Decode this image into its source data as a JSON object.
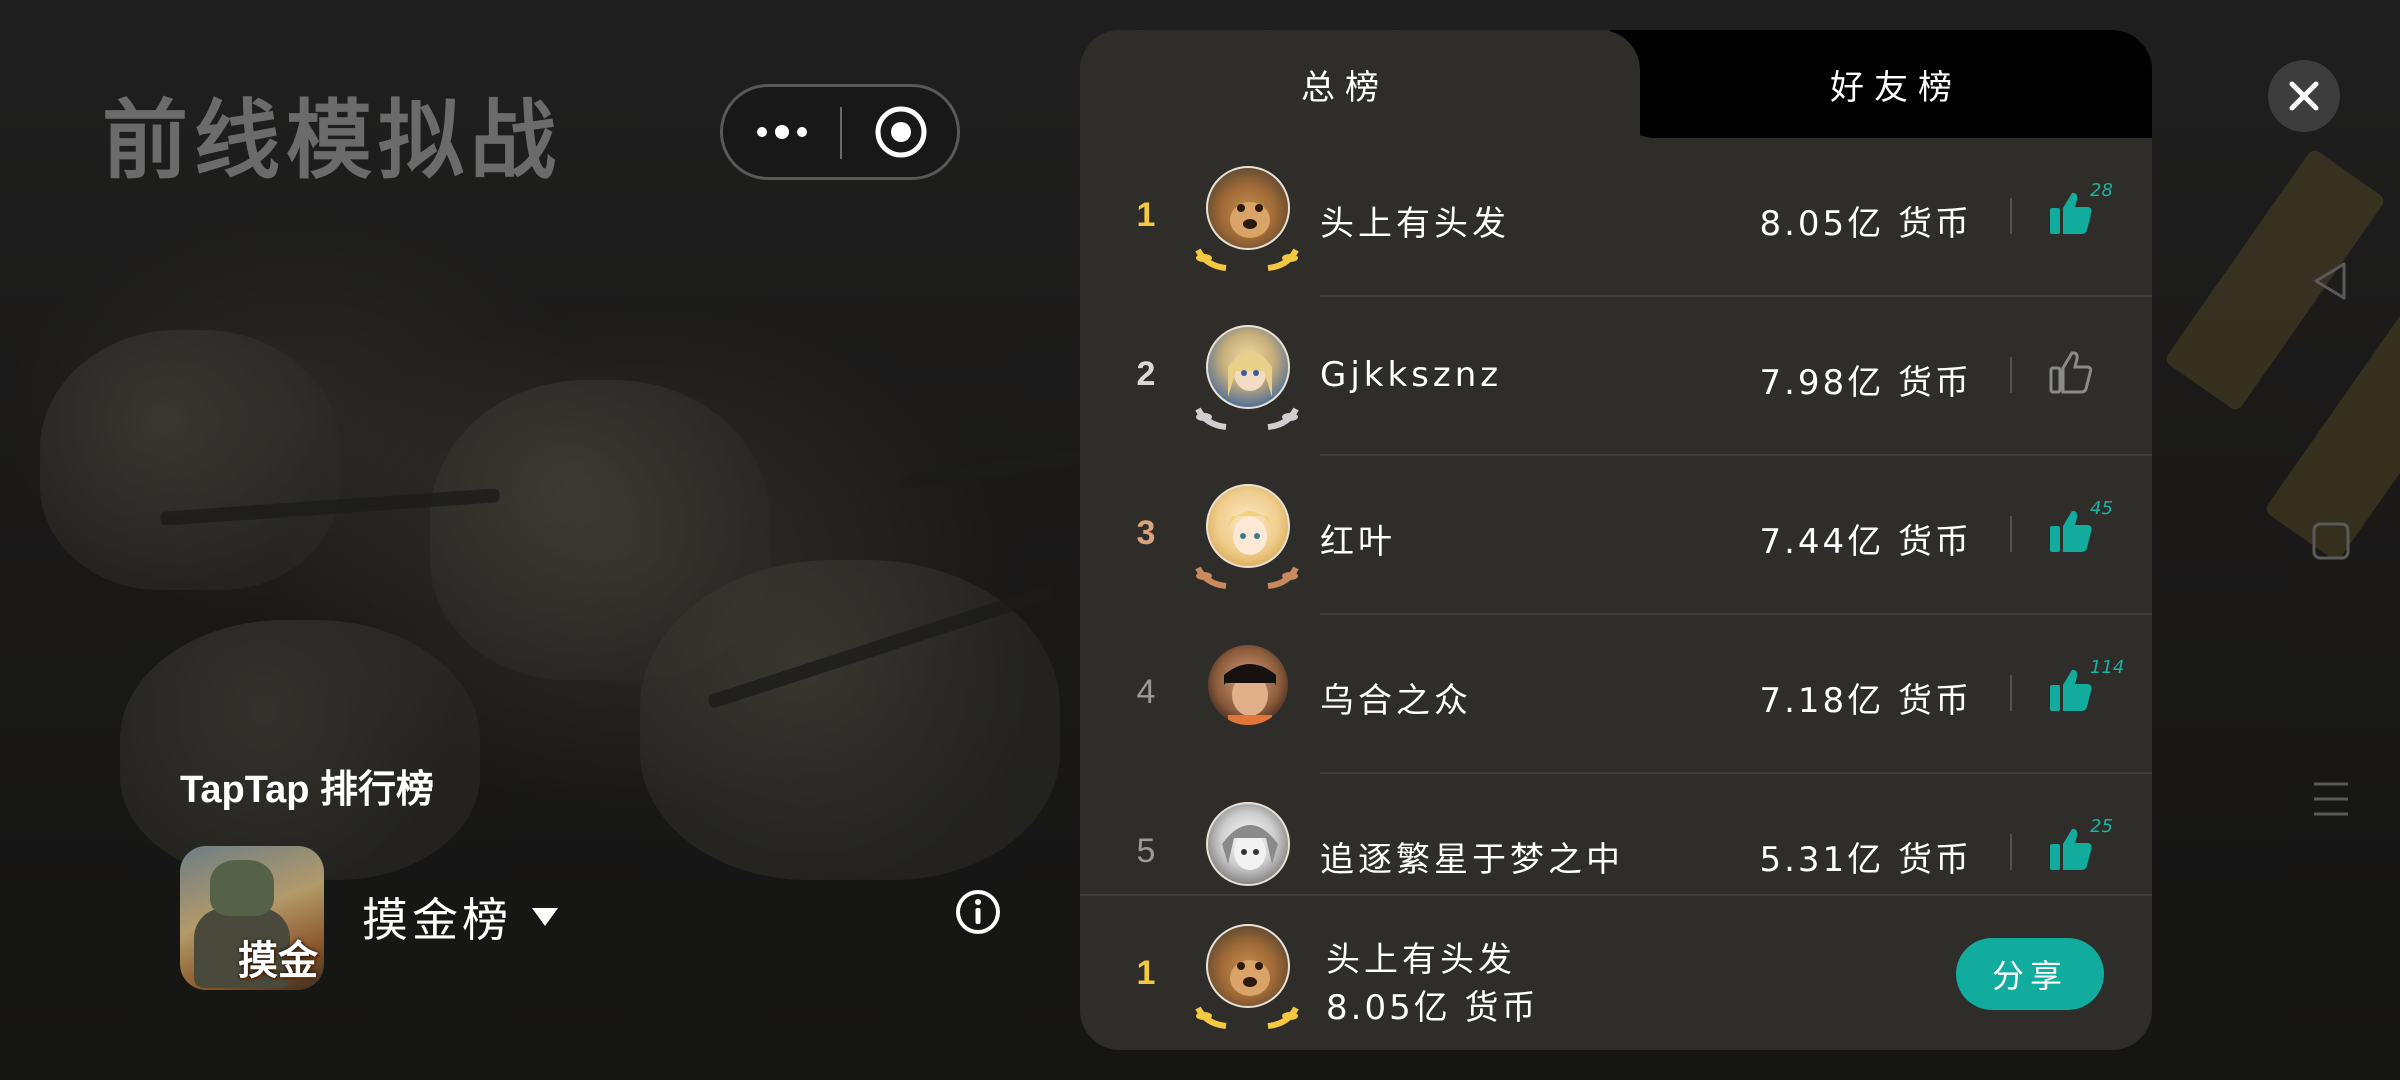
{
  "game": {
    "title": "前线模拟战",
    "icon_label": "摸金"
  },
  "capsule": {
    "more_icon": "more-dots-icon",
    "target_icon": "target-circle-icon"
  },
  "panel_brand": "TapTap 排行榜",
  "board_select": {
    "label": "摸金榜",
    "icon": "triangle-down-icon"
  },
  "tabs": {
    "total": "总榜",
    "friends": "好友榜",
    "active": "total"
  },
  "rank_colors": {
    "1": "#f5c842",
    "2": "#d9d9d9",
    "3": "#d9a37e",
    "other": "#9a9a9a"
  },
  "entries": [
    {
      "rank": "1",
      "name": "头上有头发",
      "score": "8.05亿 货币",
      "liked": true,
      "likes": "28"
    },
    {
      "rank": "2",
      "name": "Gjkksznz",
      "score": "7.98亿 货币",
      "liked": false,
      "likes": ""
    },
    {
      "rank": "3",
      "name": "红叶",
      "score": "7.44亿 货币",
      "liked": true,
      "likes": "45"
    },
    {
      "rank": "4",
      "name": "乌合之众",
      "score": "7.18亿 货币",
      "liked": true,
      "likes": "114"
    },
    {
      "rank": "5",
      "name": "追逐繁星于梦之中",
      "score": "5.31亿 货币",
      "liked": true,
      "likes": "25"
    }
  ],
  "me": {
    "rank": "1",
    "name": "头上有头发",
    "score": "8.05亿 货币"
  },
  "share_label": "分享",
  "accent_color": "#12ac9f"
}
